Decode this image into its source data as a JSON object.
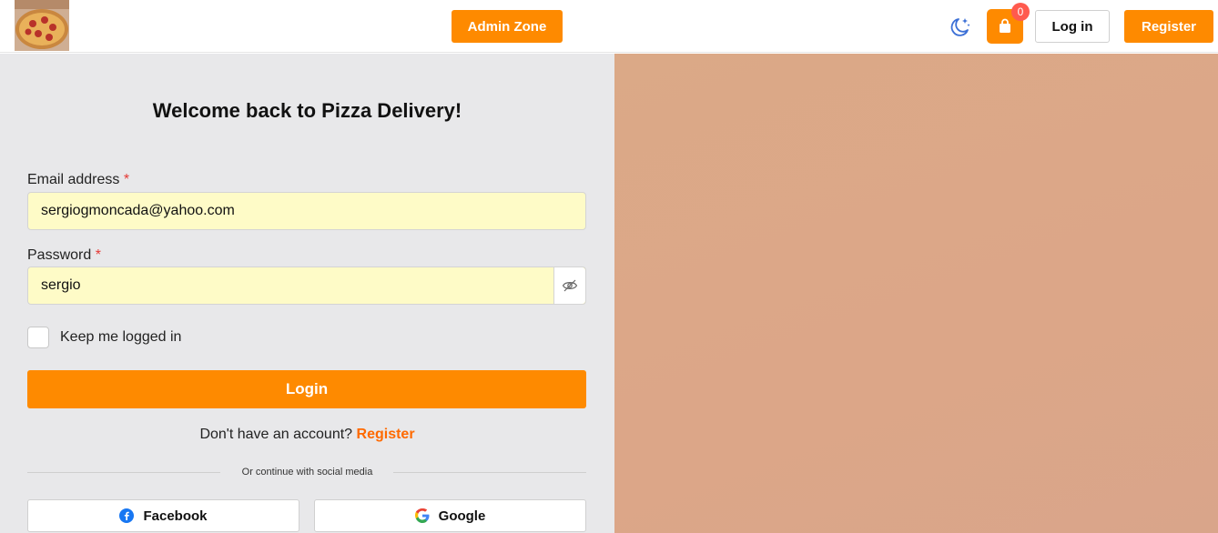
{
  "header": {
    "logo_alt": "pizza logo",
    "admin_label": "Admin Zone",
    "cart_count": "0",
    "login_label": "Log in",
    "register_label": "Register",
    "theme_icon": "moon-stars-icon",
    "cart_icon": "shopping-bag-icon"
  },
  "form": {
    "title": "Welcome back to Pizza Delivery!",
    "email_label": "Email address",
    "required_mark": "*",
    "email_value": "sergiogmoncada@yahoo.com",
    "password_label": "Password",
    "password_value": "sergio",
    "eye_icon": "eye-off-icon",
    "keep_logged_label": "Keep me logged in",
    "submit_label": "Login",
    "no_account_text": "Don't have an account?",
    "register_link": "Register",
    "divider_text": "Or continue with social media",
    "facebook_label": "Facebook",
    "google_label": "Google"
  },
  "colors": {
    "accent": "#fe8a00",
    "input_bg": "#fefbc7",
    "panel_bg": "#e8e8ea",
    "image_panel": "#dba987"
  }
}
